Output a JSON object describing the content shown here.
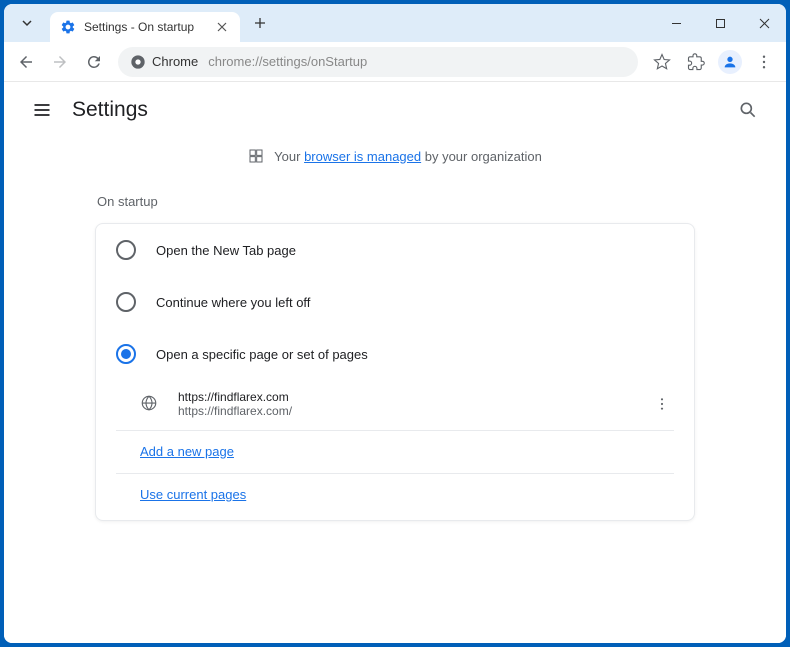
{
  "window": {
    "tab_title": "Settings - On startup"
  },
  "toolbar": {
    "chrome_label": "Chrome",
    "url": "chrome://settings/onStartup"
  },
  "settings": {
    "title": "Settings",
    "managed_prefix": "Your ",
    "managed_link": "browser is managed",
    "managed_suffix": " by your organization",
    "section_title": "On startup",
    "options": [
      {
        "label": "Open the New Tab page",
        "selected": false
      },
      {
        "label": "Continue where you left off",
        "selected": false
      },
      {
        "label": "Open a specific page or set of pages",
        "selected": true
      }
    ],
    "pages": [
      {
        "title": "https://findflarex.com",
        "url": "https://findflarex.com/"
      }
    ],
    "add_page": "Add a new page",
    "use_current": "Use current pages"
  }
}
